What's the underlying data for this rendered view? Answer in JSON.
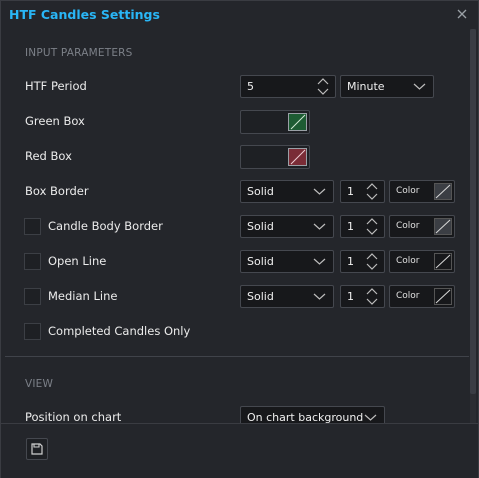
{
  "window": {
    "title": "HTF Candles Settings"
  },
  "sections": {
    "input_params": "INPUT PARAMETERS",
    "view": "VIEW"
  },
  "htf_period": {
    "label": "HTF Period",
    "value": "5",
    "unit": "Minute"
  },
  "green_box": {
    "label": "Green Box",
    "color": "#4caf50"
  },
  "red_box": {
    "label": "Red Box",
    "color": "#d94f5f"
  },
  "box_border": {
    "label": "Box Border",
    "style": "Solid",
    "width": "1",
    "color_label": "Color"
  },
  "candle_body_border": {
    "label": "Candle Body Border",
    "checked": false,
    "style": "Solid",
    "width": "1",
    "color_label": "Color"
  },
  "open_line": {
    "label": "Open Line",
    "checked": false,
    "style": "Solid",
    "width": "1",
    "color_label": "Color"
  },
  "median_line": {
    "label": "Median Line",
    "checked": false,
    "style": "Solid",
    "width": "1",
    "color_label": "Color"
  },
  "completed_only": {
    "label": "Completed Candles Only",
    "checked": false
  },
  "position": {
    "label": "Position on chart",
    "value": "On chart background"
  },
  "colors": {
    "accent": "#29b6f6",
    "panel": "#24262b",
    "field": "#17181b"
  },
  "icons": {
    "close": "close-icon",
    "save": "save-template-icon"
  }
}
